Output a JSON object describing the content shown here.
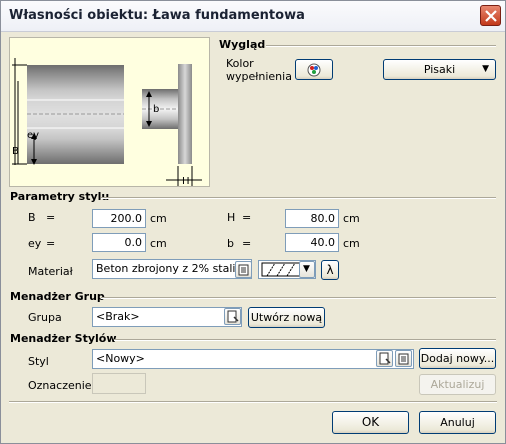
{
  "window": {
    "title": "Własności obiektu: Ława fundamentowa"
  },
  "preview": {
    "label_b": "b",
    "label_ey": "ey",
    "label_B": "B",
    "label_H": "H"
  },
  "appearance": {
    "title": "Wygląd",
    "fill_color_label_line1": "Kolor",
    "fill_color_label_line2": "wypełnienia",
    "pens_button": "Pisaki"
  },
  "style_params": {
    "title": "Parametry stylu",
    "B_label": "B",
    "B_eq": "=",
    "B_value": "200.0",
    "B_unit": "cm",
    "H_label": "H",
    "H_eq": "=",
    "H_value": "80.0",
    "H_unit": "cm",
    "ey_label": "ey",
    "ey_eq": "=",
    "ey_value": "0.0",
    "ey_unit": "cm",
    "b_label": "b",
    "b_eq": "=",
    "b_value": "40.0",
    "b_unit": "cm",
    "material_label": "Materiał",
    "material_value": "Beton zbrojony z 2% stali",
    "lambda_button": "λ"
  },
  "group_manager": {
    "title": "Menadżer Grup",
    "group_label": "Grupa",
    "group_value": "<Brak>",
    "create_new_button": "Utwórz nową"
  },
  "style_manager": {
    "title": "Menadżer Stylów",
    "style_label": "Styl",
    "style_value": "<Nowy>",
    "add_new_button": "Dodaj nowy...",
    "designation_label": "Oznaczenie",
    "designation_value": "",
    "update_button": "Aktualizuj"
  },
  "footer": {
    "ok_button": "OK",
    "cancel_button": "Anuluj"
  }
}
